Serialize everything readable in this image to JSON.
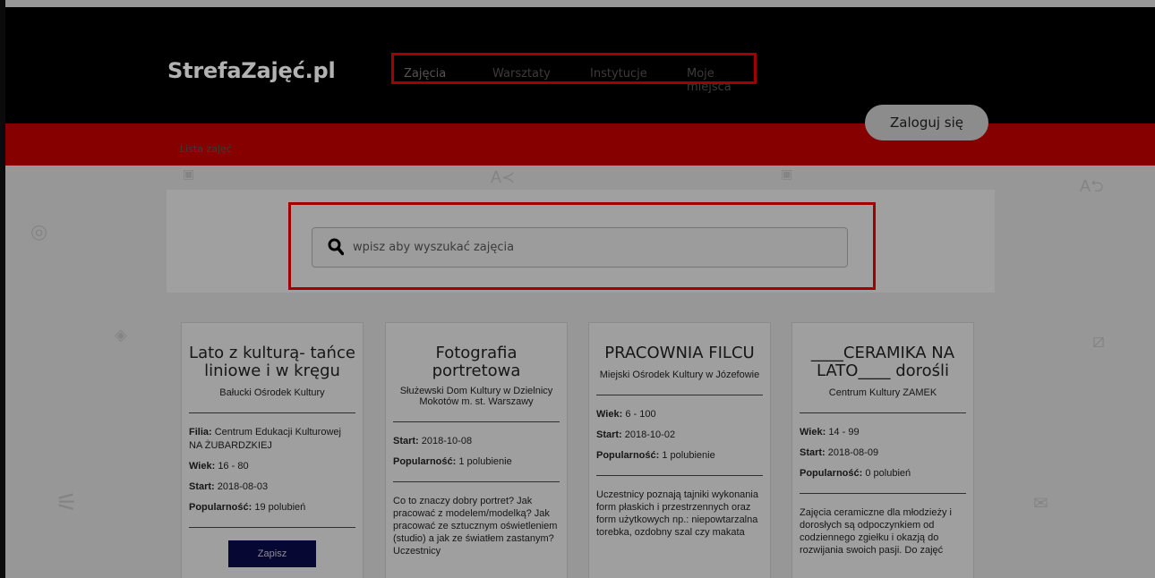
{
  "header": {
    "logo": "StrefaZajęć.pl",
    "nav": [
      "Zajęcia",
      "Warsztaty",
      "Instytucje",
      "Moje miejsca"
    ],
    "login_label": "Zaloguj się"
  },
  "breadcrumb": "Lista zajęć",
  "search": {
    "placeholder": "wpisz aby wyszukać zajęcia"
  },
  "cards": [
    {
      "title": "Lato z kulturą- tańce liniowe i w kręgu",
      "org": "Bałucki Ośrodek Kultury",
      "filia_label": "Filia:",
      "filia": "Centrum Edukacji Kulturowej NA ŻUBARDZKIEJ",
      "age_label": "Wiek:",
      "age": "16 - 80",
      "start_label": "Start:",
      "start": "2018-08-03",
      "pop_label": "Popularność:",
      "popularity": "19 polubień",
      "button": "Zapisz"
    },
    {
      "title": "Fotografia portretowa",
      "org": "Służewski Dom Kultury w Dzielnicy Mokotów m. st. Warszawy",
      "start_label": "Start:",
      "start": "2018-10-08",
      "pop_label": "Popularność:",
      "popularity": "1 polubienie",
      "desc": "Co to znaczy dobry portret? Jak pracować z modelem/modelką? Jak pracować ze sztucznym oświetleniem (studio) a jak ze światłem zastanym? Uczestnicy"
    },
    {
      "title": "PRACOWNIA FILCU",
      "org": "Miejski Ośrodek Kultury w Józefowie",
      "age_label": "Wiek:",
      "age": "6 - 100",
      "start_label": "Start:",
      "start": "2018-10-02",
      "pop_label": "Popularność:",
      "popularity": "1 polubienie",
      "desc": "Uczestnicy poznają tajniki wykonania form płaskich i przestrzennych oraz form użytkowych np.: niepowtarzalna torebka, ozdobny szal czy makata"
    },
    {
      "title": "____CERAMIKA NA LATO____ dorośli",
      "org": "Centrum Kultury ZAMEK",
      "age_label": "Wiek:",
      "age": "14 - 99",
      "start_label": "Start:",
      "start": "2018-08-09",
      "pop_label": "Popularność:",
      "popularity": "0 polubień",
      "desc": "Zajęcia ceramiczne dla młodzieży i dorosłych są odpoczynkiem od codziennego zgiełku i okazją do rozwijania swoich pasji. Do zajęć"
    }
  ]
}
